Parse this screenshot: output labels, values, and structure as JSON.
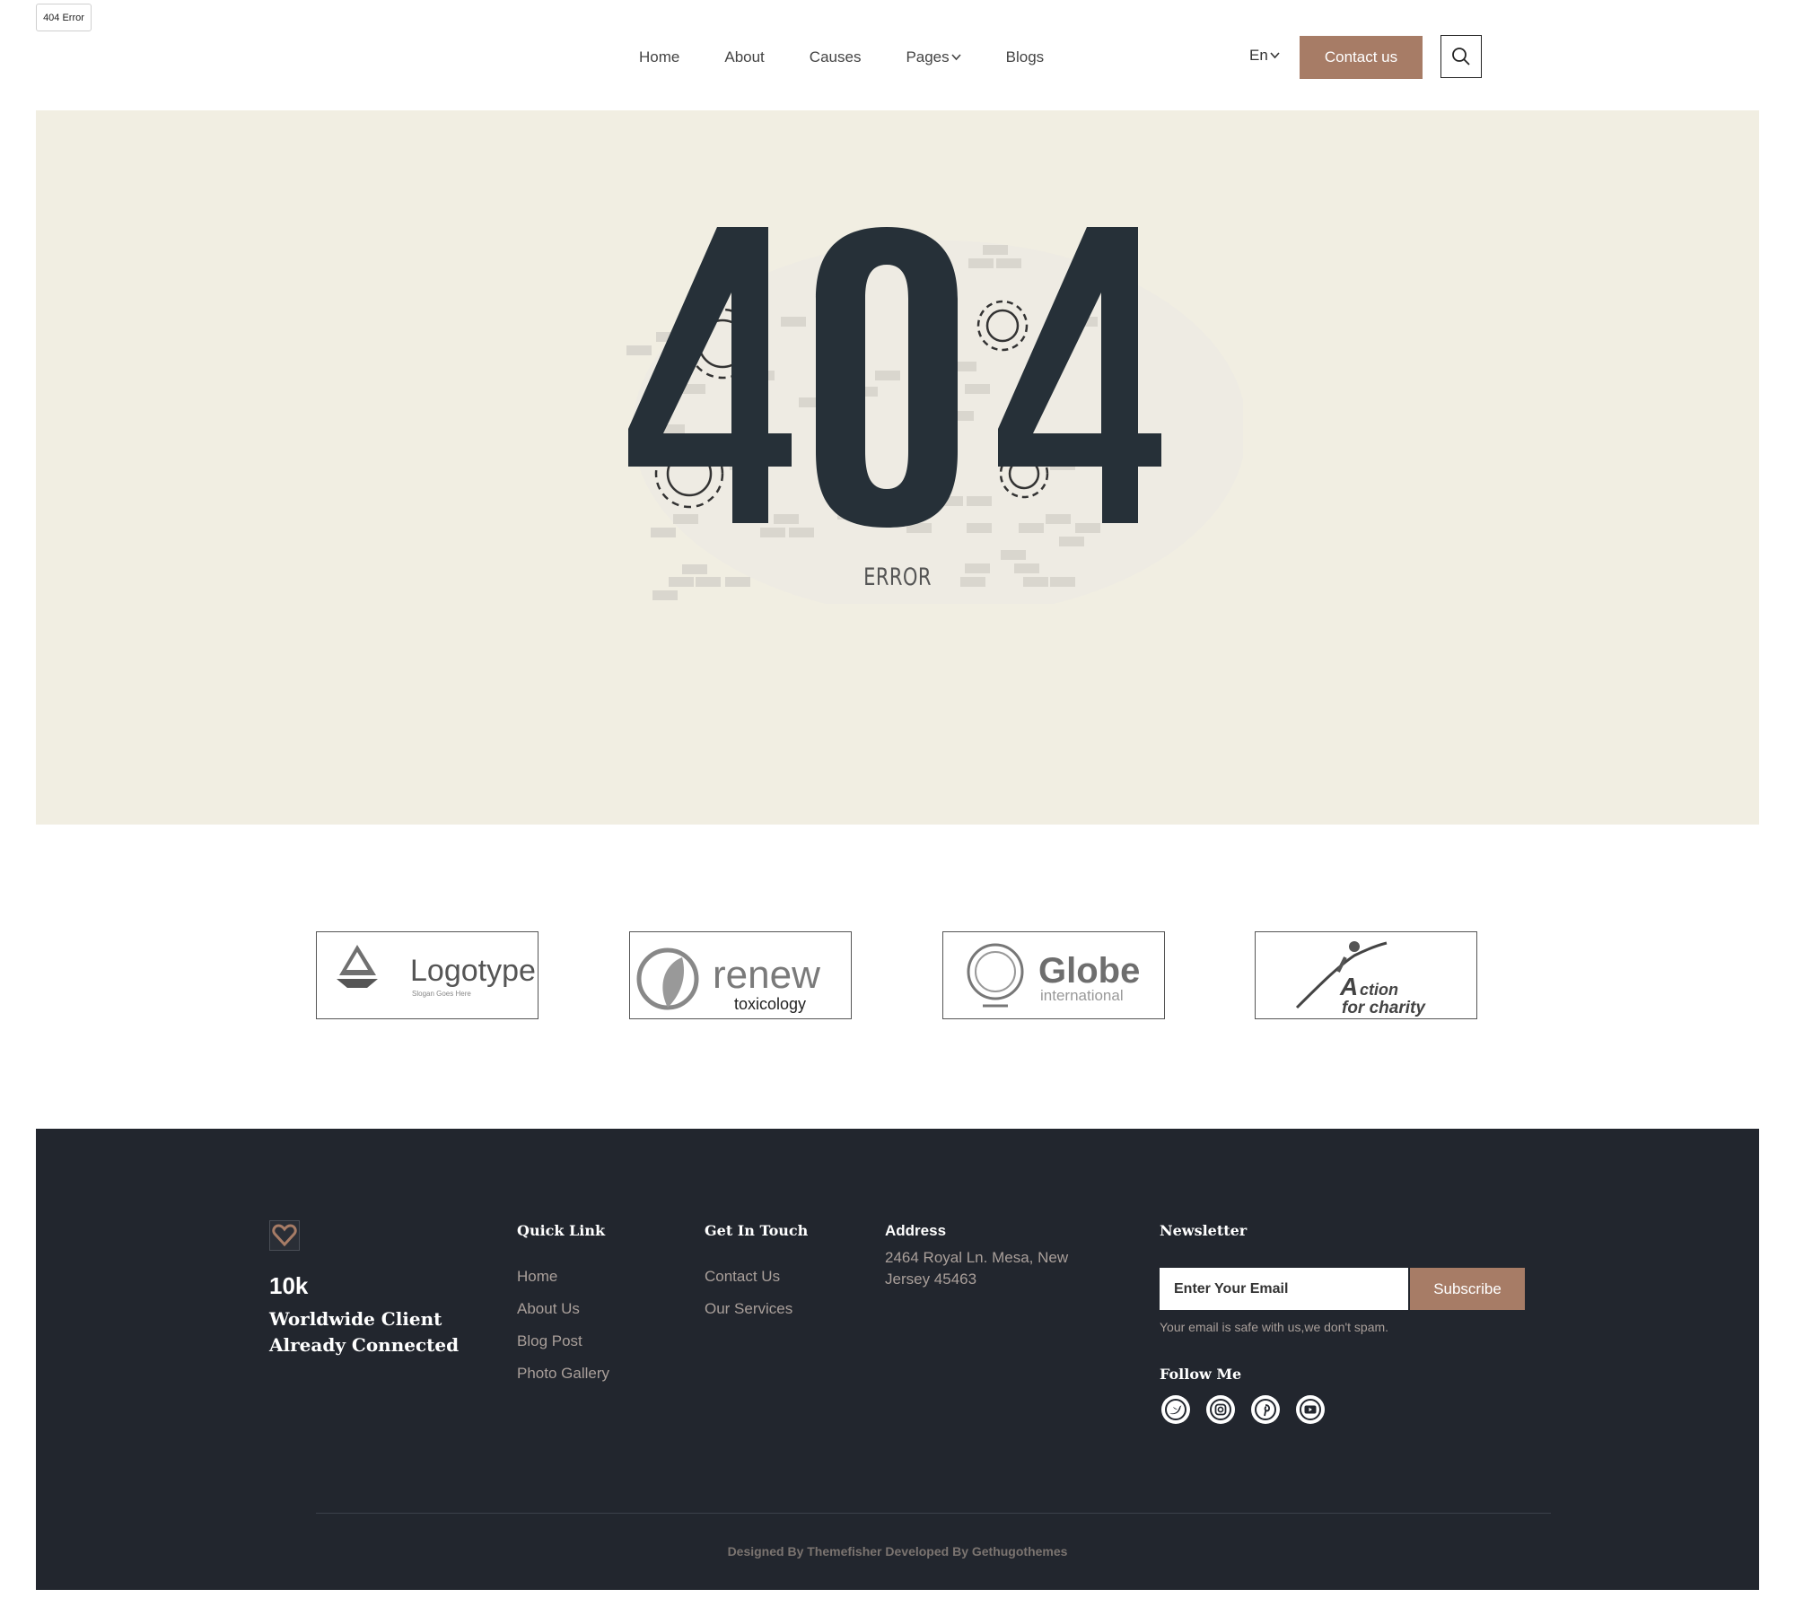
{
  "tab": {
    "title": "404 Error"
  },
  "nav": {
    "items": [
      {
        "label": "Home"
      },
      {
        "label": "About"
      },
      {
        "label": "Causes"
      },
      {
        "label": "Pages",
        "dropdown": true
      },
      {
        "label": "Blogs"
      }
    ],
    "language": "En",
    "contact_label": "Contact us",
    "search_icon": "search-icon"
  },
  "hero": {
    "code": "404",
    "error_label": "ERROR",
    "colors": {
      "background": "#f1eee2",
      "digits": "#263038",
      "accent": "#a77c66"
    }
  },
  "partners": [
    {
      "name": "Logotype",
      "slogan": "Slogan Goes Here"
    },
    {
      "name": "renew",
      "sub": "toxicology"
    },
    {
      "name": "Globe",
      "sub": "international"
    },
    {
      "name": "ction",
      "prefix": "A",
      "sub": "for charity"
    }
  ],
  "footer": {
    "count": "10k",
    "tagline": "Worldwide Client Already Connected",
    "quick_link": {
      "heading": "Quick Link",
      "links": [
        "Home",
        "About Us",
        "Blog Post",
        "Photo Gallery"
      ]
    },
    "get_in_touch": {
      "heading": "Get In Touch",
      "links": [
        "Contact Us",
        "Our Services"
      ]
    },
    "address": {
      "heading": "Address",
      "text": "2464 Royal Ln. Mesa, New Jersey 45463"
    },
    "newsletter": {
      "heading": "Newsletter",
      "placeholder": "Enter Your Email",
      "button": "Subscribe",
      "note": "Your email is safe with us,we don't spam."
    },
    "follow": {
      "heading": "Follow Me",
      "icons": [
        "twitter-icon",
        "instagram-icon",
        "pinterest-icon",
        "youtube-icon"
      ]
    },
    "credit": "Designed By Themefisher Developed By Gethugothemes"
  }
}
